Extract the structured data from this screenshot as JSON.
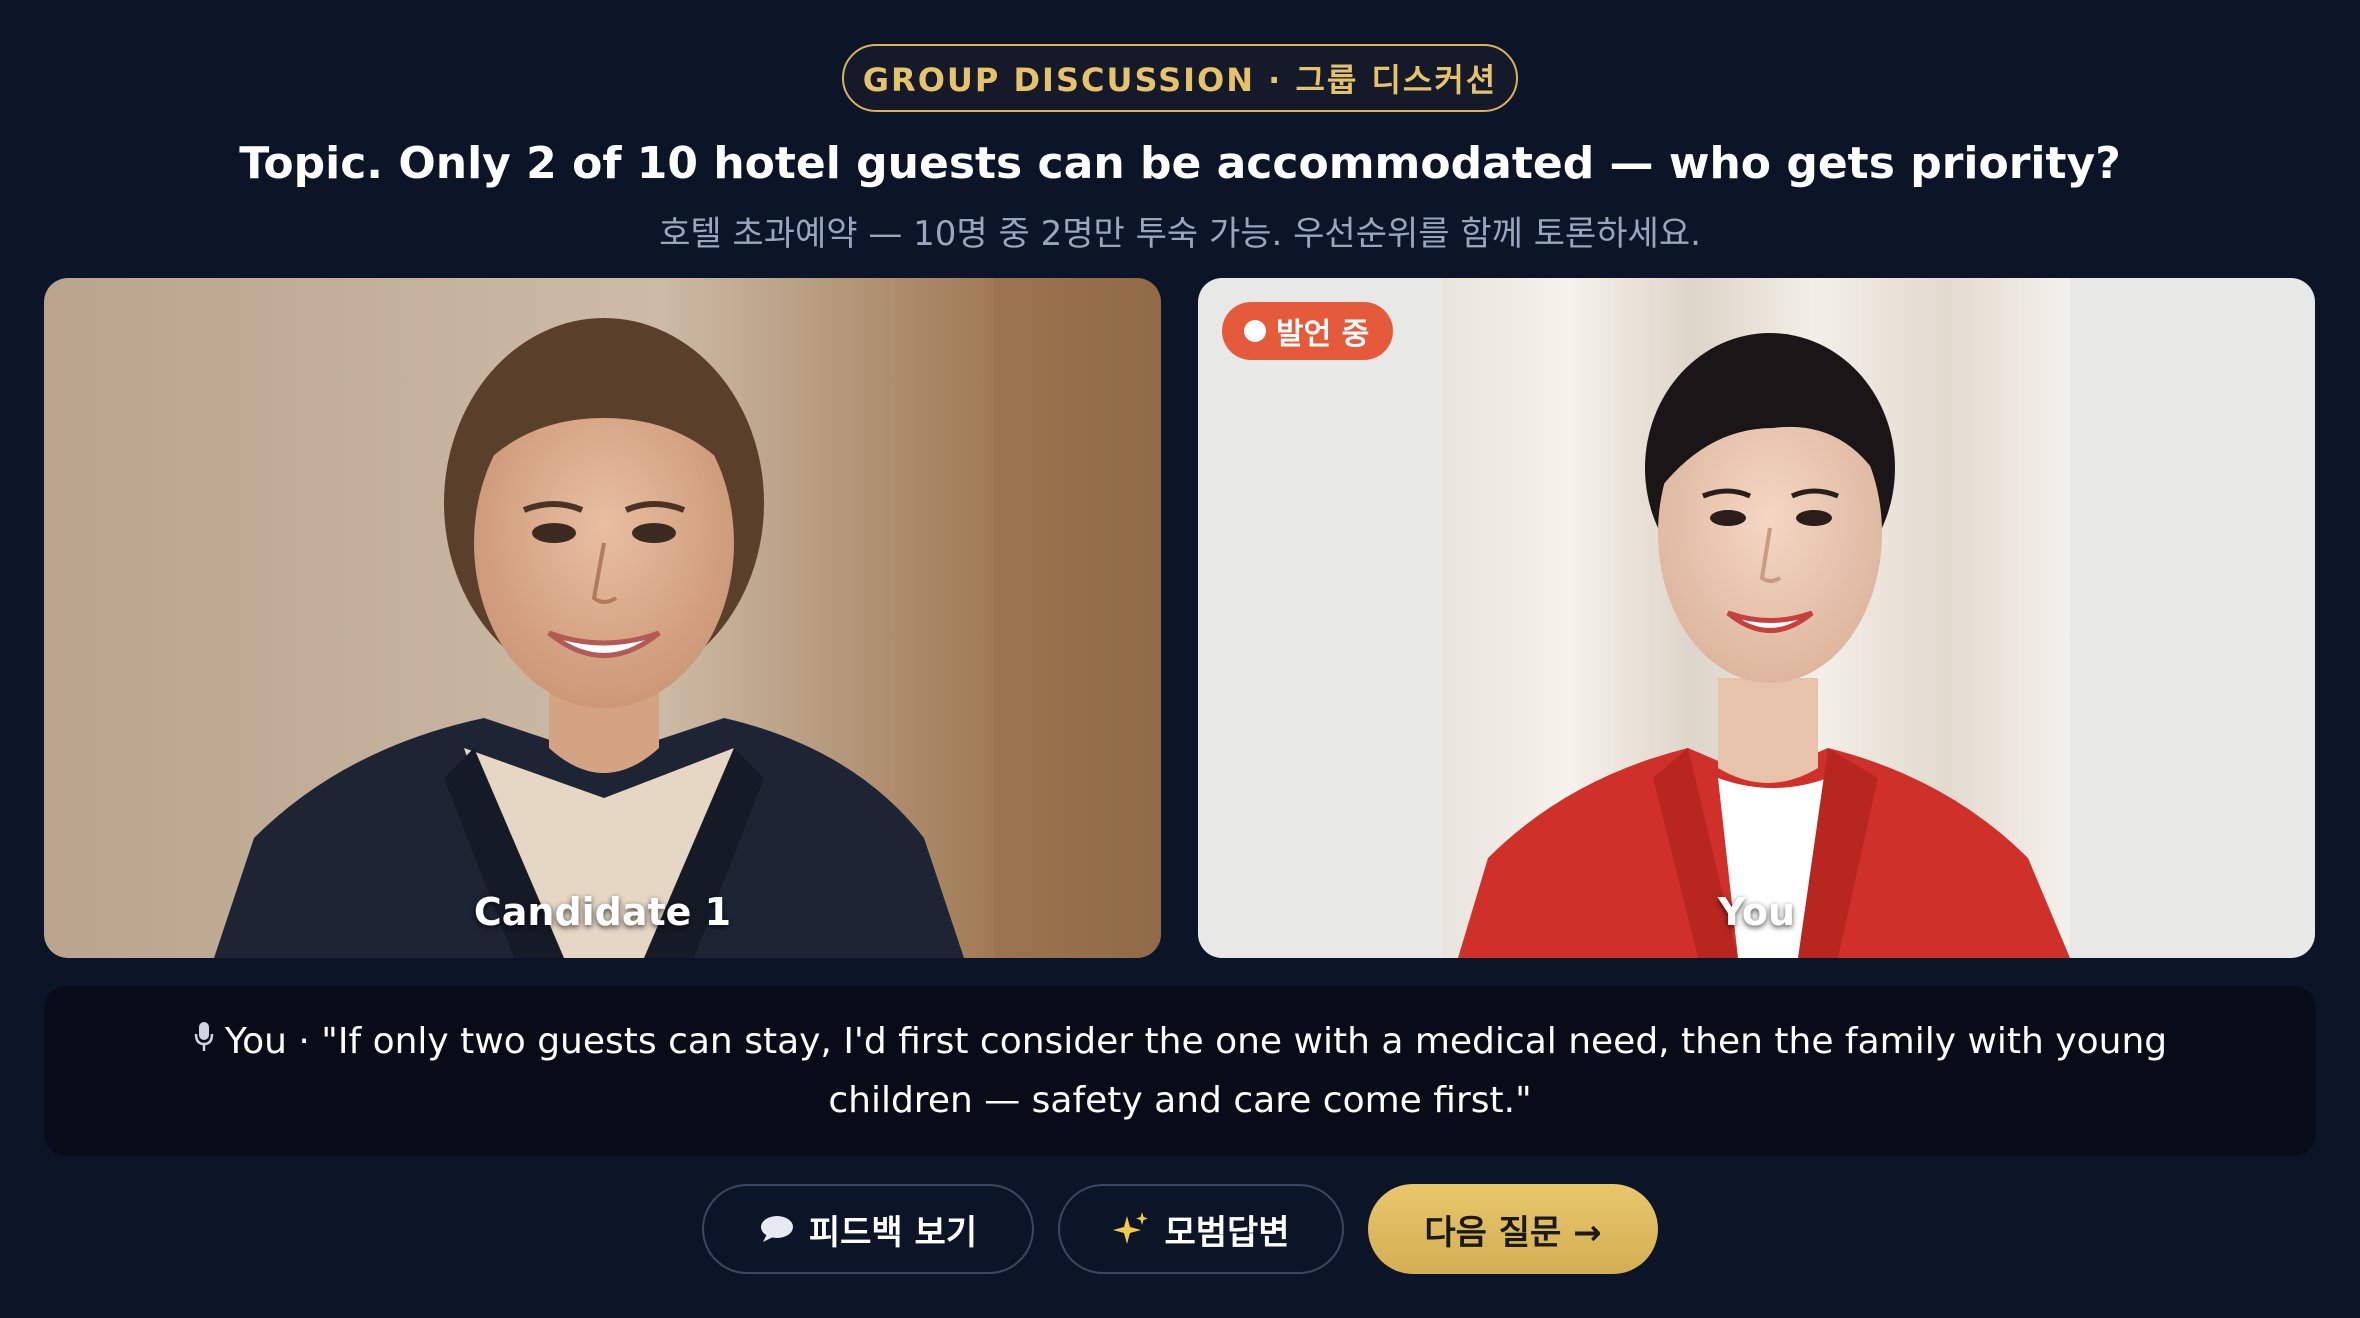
{
  "header": {
    "mode_label": "GROUP DISCUSSION · 그룹 디스커션",
    "topic_title": "Topic. Only 2 of 10 hotel guests can be accommodated — who gets priority?",
    "topic_subtitle": "호텔 초과예약 — 10명 중 2명만 투숙 가능. 우선순위를 함께 토론하세요."
  },
  "participants": [
    {
      "name": "Candidate 1",
      "speaking": false
    },
    {
      "name": "You",
      "speaking": true,
      "badge": "발언 중"
    }
  ],
  "transcript": {
    "speaker": "You",
    "separator": " · ",
    "quote": "\"If only two guests can stay, I'd first consider the one with a medical need, then the family with young children — safety and care come first.\""
  },
  "actions": {
    "feedback_label": "피드백 보기",
    "model_answer_label": "모범답변",
    "next_question_label": "다음 질문 →"
  },
  "icons": {
    "feedback": "speech-bubble-icon",
    "model_answer": "sparkles-icon",
    "transcript": "microphone-icon"
  },
  "colors": {
    "background": "#0c1428",
    "accent_gold": "#d9b35a",
    "speaking_badge": "#e55a3a"
  }
}
